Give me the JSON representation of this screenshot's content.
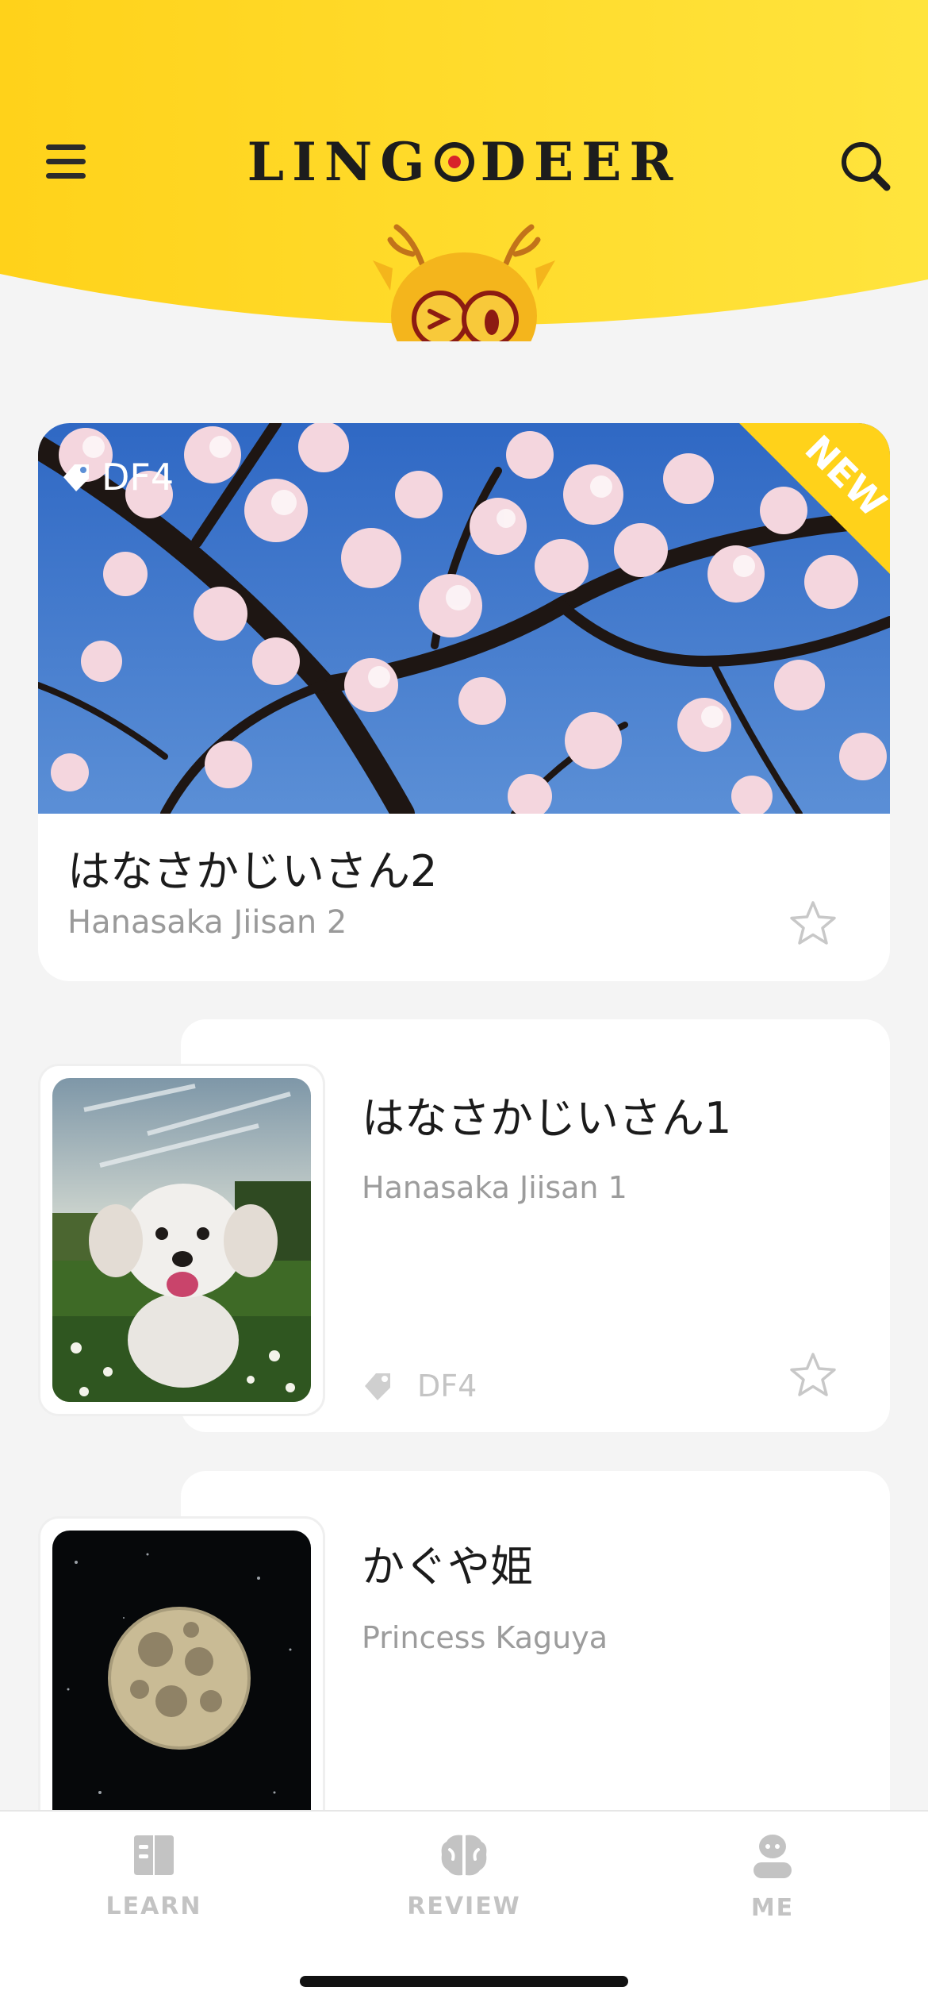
{
  "header": {
    "logo_text": "LINGODEER",
    "logo_left": "LING",
    "logo_right": "DEER",
    "background_color": "#ffd91e"
  },
  "featured": {
    "tag": "DF4",
    "badge": "NEW",
    "title": "はなさかじいさん2",
    "subtitle": "Hanasaka Jiisan 2"
  },
  "stories": [
    {
      "title": "はなさかじいさん1",
      "subtitle": "Hanasaka Jiisan 1",
      "tag": "DF4"
    },
    {
      "title": "かぐや姫",
      "subtitle": "Princess Kaguya"
    }
  ],
  "tabbar": {
    "items": [
      {
        "label": "LEARN",
        "icon": "book-icon"
      },
      {
        "label": "REVIEW",
        "icon": "brain-icon"
      },
      {
        "label": "ME",
        "icon": "profile-icon"
      }
    ]
  },
  "colors": {
    "accent": "#ffd91e",
    "inactive_tab": "#c3c3c3",
    "sky": "#3f79c8"
  }
}
